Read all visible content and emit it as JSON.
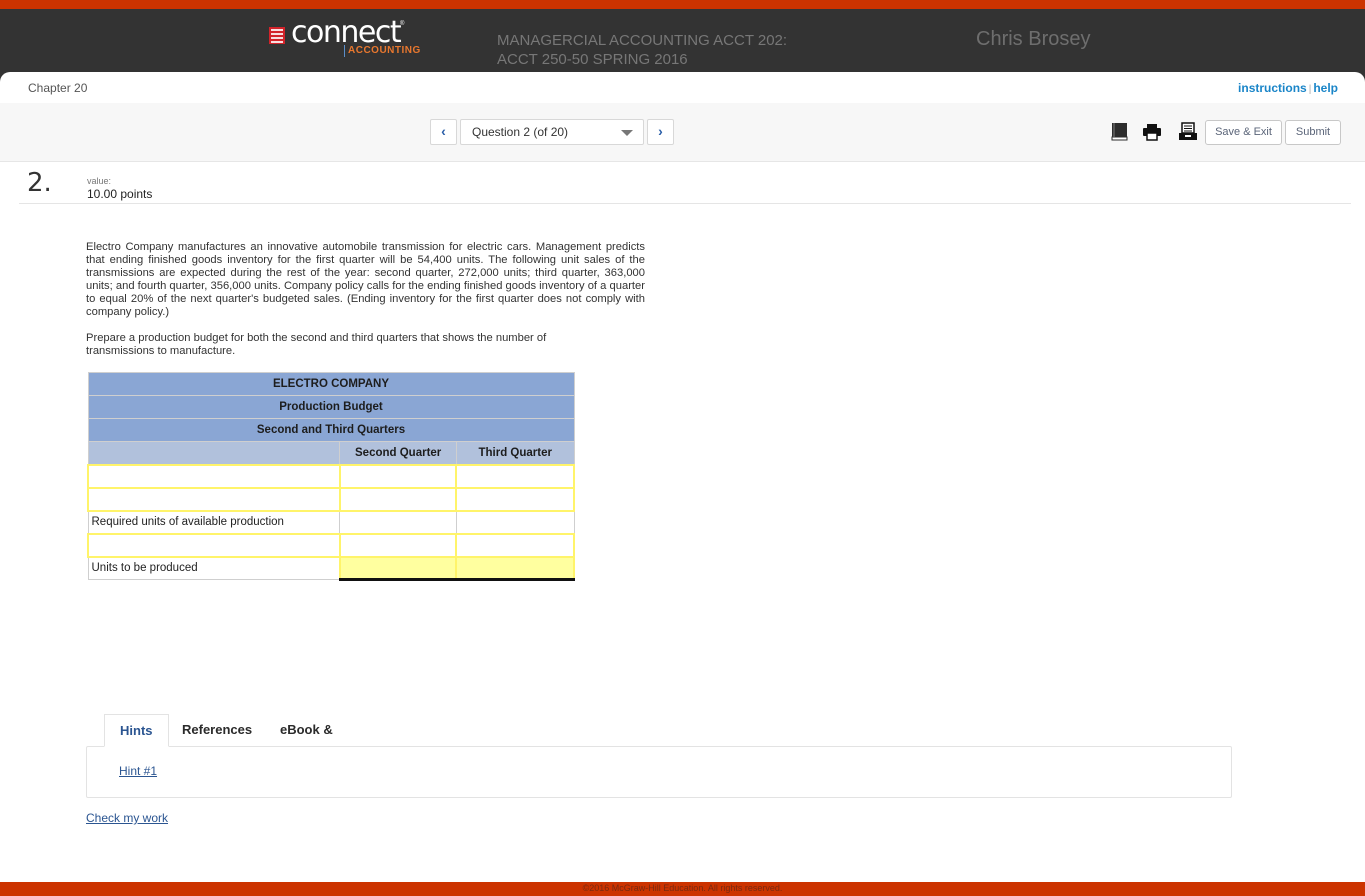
{
  "header": {
    "logo_word": "connect",
    "logo_registered": "®",
    "logo_subtitle": "ACCOUNTING",
    "course_title": "MANAGERCIAL ACCOUNTING ACCT 202: ACCT 250-50 SPRING 2016",
    "user_name": "Chris Brosey"
  },
  "subheader": {
    "chapter": "Chapter 20",
    "instructions_link": "instructions",
    "separator": "|",
    "help_link": "help"
  },
  "toolbar": {
    "prev_icon": "‹",
    "next_icon": "›",
    "question_selector": "Question 2 (of 20)",
    "icons": [
      "ebook-icon",
      "print-icon",
      "archive-icon"
    ],
    "save_exit_label": "Save & Exit",
    "submit_label": "Submit"
  },
  "question": {
    "number": "2.",
    "value_label": "value:",
    "points": "10.00 points",
    "paragraphs": [
      "Electro Company manufactures an innovative automobile transmission for electric cars. Management predicts that ending finished goods inventory for the first quarter will be 54,400 units. The following unit sales of the transmissions are expected during the rest of the year: second quarter, 272,000 units; third quarter, 363,000 units; and fourth quarter, 356,000 units. Company policy calls for the ending finished goods inventory of a quarter to equal 20% of the next quarter's budgeted sales. (Ending inventory for the first quarter does not comply with company policy.)",
      "Prepare a production budget for both the second and third quarters that shows the number of transmissions to manufacture."
    ]
  },
  "budget_table": {
    "title_rows": [
      "ELECTRO COMPANY",
      "Production Budget",
      "Second and Third Quarters"
    ],
    "columns": [
      "",
      "Second Quarter",
      "Third Quarter"
    ],
    "rows": [
      {
        "label": "",
        "label_input": true,
        "q2": "",
        "q3": ""
      },
      {
        "label": "",
        "label_input": true,
        "q2": "",
        "q3": ""
      },
      {
        "label": "Required units of available production",
        "label_input": false,
        "q2": "",
        "q3": ""
      },
      {
        "label": "",
        "label_input": true,
        "q2": "",
        "q3": ""
      },
      {
        "label": "Units to be produced",
        "label_input": false,
        "q2": "",
        "q3": ""
      }
    ]
  },
  "tabs": {
    "items": [
      "Hints",
      "References",
      "eBook & Resources"
    ],
    "active": "Hints",
    "hint_link": "Hint #1"
  },
  "check_my_work": "Check my work",
  "footer": {
    "copyright": "©2016 McGraw-Hill Education. All rights reserved."
  },
  "colors": {
    "brand_orange": "#cc3300",
    "header_bg": "#333333",
    "link_blue": "#1a85c8",
    "table_header": "#8aa6d4",
    "table_subheader": "#b1c1dc",
    "input_border": "#fff46a",
    "total_fill": "#ffff9f"
  }
}
